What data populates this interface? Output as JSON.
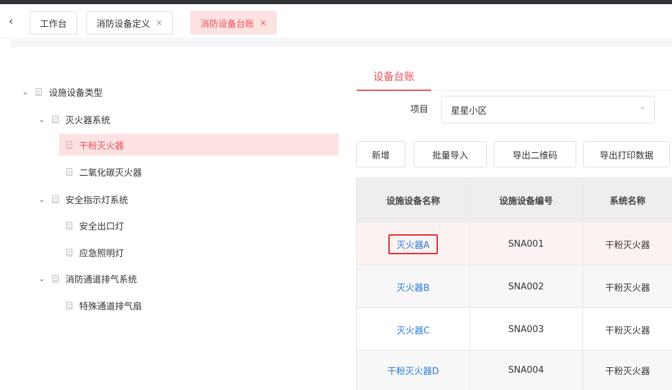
{
  "tabs": [
    {
      "label": "工作台",
      "closable": false
    },
    {
      "label": "消防设备定义",
      "closable": true
    },
    {
      "label": "消防设备台账",
      "closable": true,
      "active": true
    }
  ],
  "tab_close_glyph": "×",
  "back_glyph": "‹",
  "tree": {
    "root": "设施设备类型",
    "groups": [
      {
        "label": "灭火器系统",
        "children": [
          "干粉灭火器",
          "二氧化碳灭火器"
        ]
      },
      {
        "label": "安全指示灯系统",
        "children": [
          "安全出口灯",
          "应急照明灯"
        ]
      },
      {
        "label": "消防通道排气系统",
        "children": [
          "特殊通道排气扇"
        ]
      }
    ],
    "selected": "干粉灭火器"
  },
  "panel": {
    "tab_label": "设备台账",
    "project_label": "项目",
    "project_value": "星星小区",
    "buttons": [
      "新增",
      "批量导入",
      "导出二维码",
      "导出打印数据"
    ]
  },
  "table": {
    "headers": [
      "设施设备名称",
      "设施设备编号",
      "系统名称"
    ],
    "rows": [
      {
        "name": "灭火器A",
        "code": "SNA001",
        "system": "干粉灭火器"
      },
      {
        "name": "灭火器B",
        "code": "SNA002",
        "system": "干粉灭火器"
      },
      {
        "name": "灭火器C",
        "code": "SNA003",
        "system": "干粉灭火器"
      },
      {
        "name": "干粉灭火器D",
        "code": "SNA004",
        "system": "干粉灭火器"
      }
    ]
  },
  "colors": {
    "accent": "#e9505b",
    "link": "#2a7dd6",
    "highlight_box": "#e52d2d"
  },
  "icons": {
    "tree_expand": "chevron-down-icon",
    "tree_node": "document-icon",
    "select": "chevron-down-icon",
    "back": "chevron-left-icon",
    "tab_close": "close-icon"
  }
}
